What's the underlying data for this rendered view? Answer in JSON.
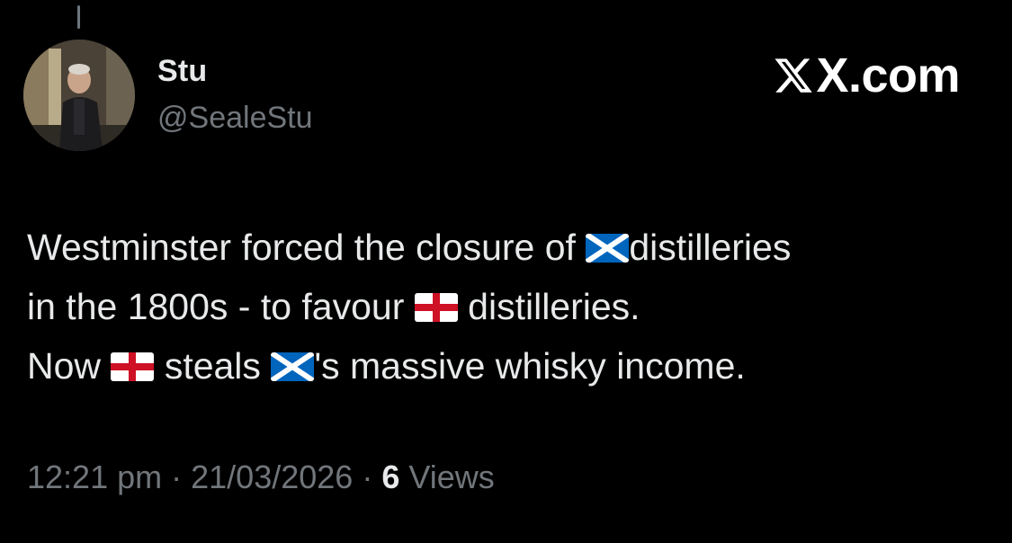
{
  "tweet": {
    "author": {
      "display_name": "Stu",
      "handle": "@SealeStu"
    },
    "brand": "X.com",
    "text": {
      "line1_a": "Westminster forced the closure of ",
      "line1_b": "distilleries",
      "line2_a": "in the 1800s - to favour ",
      "line2_b": "distilleries.",
      "line3_a": "Now ",
      "line3_b": " steals ",
      "line3_c": "'s massive whisky income."
    },
    "flags": [
      "scotland-flag",
      "england-flag",
      "england-flag",
      "scotland-flag"
    ],
    "meta": {
      "time": "12:21 pm",
      "separator": "·",
      "date": "21/03/2026",
      "views_count": "6",
      "views_label": "Views"
    }
  },
  "colors": {
    "background": "#000000",
    "primary_text": "#e7e9ea",
    "secondary_text": "#71767b",
    "saltire_blue": "#0065bd",
    "st_george_red": "#ce1124"
  }
}
